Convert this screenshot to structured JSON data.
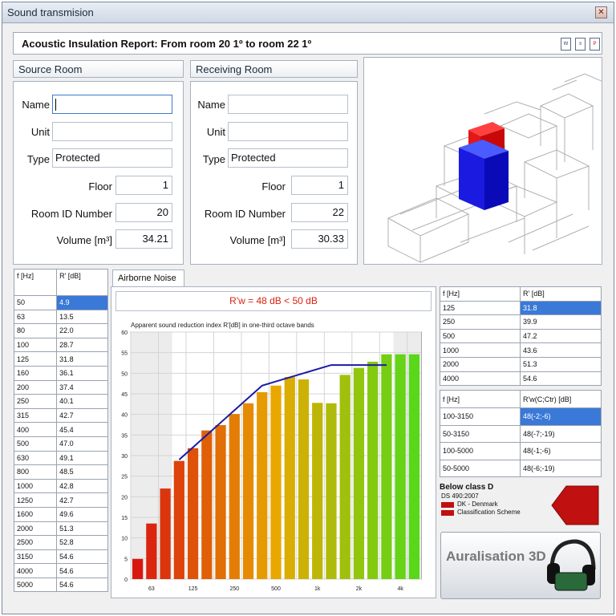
{
  "window": {
    "title": "Sound transmision",
    "close_icon": "✕"
  },
  "report": {
    "title": "Acoustic Insulation Report: From room 20  1º  to room 22  1º",
    "icons": [
      "word-document-icon",
      "export-document-icon",
      "pdf-document-icon"
    ]
  },
  "source_room": {
    "heading": "Source Room",
    "labels": {
      "name": "Name",
      "unit": "Unit",
      "type": "Type",
      "floor": "Floor",
      "room_id": "Room ID Number",
      "volume": "Volume [m³]"
    },
    "values": {
      "name": "",
      "unit": "",
      "type": "Protected",
      "floor": "1",
      "room_id": "20",
      "volume": "34.21"
    }
  },
  "receiving_room": {
    "heading": "Receiving Room",
    "labels": {
      "name": "Name",
      "unit": "Unit",
      "type": "Type",
      "floor": "Floor",
      "room_id": "Room ID Number",
      "volume": "Volume [m³]"
    },
    "values": {
      "name": "",
      "unit": "",
      "type": "Protected",
      "floor": "1",
      "room_id": "22",
      "volume": "30.33"
    }
  },
  "freq_table": {
    "headers": [
      "f [Hz]",
      "R' [dB]"
    ],
    "rows": [
      [
        "50",
        "4.9"
      ],
      [
        "63",
        "13.5"
      ],
      [
        "80",
        "22.0"
      ],
      [
        "100",
        "28.7"
      ],
      [
        "125",
        "31.8"
      ],
      [
        "160",
        "36.1"
      ],
      [
        "200",
        "37.4"
      ],
      [
        "250",
        "40.1"
      ],
      [
        "315",
        "42.7"
      ],
      [
        "400",
        "45.4"
      ],
      [
        "500",
        "47.0"
      ],
      [
        "630",
        "49.1"
      ],
      [
        "800",
        "48.5"
      ],
      [
        "1000",
        "42.8"
      ],
      [
        "1250",
        "42.7"
      ],
      [
        "1600",
        "49.6"
      ],
      [
        "2000",
        "51.3"
      ],
      [
        "2500",
        "52.8"
      ],
      [
        "3150",
        "54.6"
      ],
      [
        "4000",
        "54.6"
      ],
      [
        "5000",
        "54.6"
      ]
    ],
    "selected_row": 0
  },
  "tab": {
    "label": "Airborne Noise"
  },
  "result_banner": "R'w = 48 dB < 50 dB",
  "chart_data": {
    "type": "bar",
    "title": "Apparent sound reduction index R'[dB] in one-third octave bands",
    "categories": [
      "50",
      "63",
      "80",
      "100",
      "125",
      "160",
      "200",
      "250",
      "315",
      "400",
      "500",
      "630",
      "800",
      "1000",
      "1250",
      "1600",
      "2000",
      "2500",
      "3150",
      "4000",
      "5000"
    ],
    "values": [
      4.9,
      13.5,
      22.0,
      28.7,
      31.8,
      36.1,
      37.4,
      40.1,
      42.7,
      45.4,
      47.0,
      49.1,
      48.5,
      42.8,
      42.7,
      49.6,
      51.3,
      52.8,
      54.6,
      54.6,
      54.6
    ],
    "x_tick_labels": [
      "63",
      "125",
      "250",
      "500",
      "1k",
      "2k",
      "4k"
    ],
    "y_tick_labels": [
      "0",
      "5",
      "10",
      "15",
      "20",
      "25",
      "30",
      "35",
      "40",
      "45",
      "50",
      "55",
      "60"
    ],
    "ylim": [
      0,
      60
    ],
    "grid": true,
    "reference_curve": {
      "x": [
        "100",
        "125",
        "160",
        "200",
        "250",
        "315",
        "400",
        "500",
        "630",
        "800",
        "1000",
        "1250",
        "1600",
        "2000",
        "2500",
        "3150"
      ],
      "values": [
        29,
        32,
        35,
        38,
        41,
        44,
        47,
        48,
        49,
        50,
        51,
        52,
        52,
        52,
        52,
        52
      ]
    },
    "colors": {
      "low": "#d81810",
      "mid": "#e8a800",
      "high": "#58d818",
      "curve": "#1a1aa8"
    }
  },
  "octave_table": {
    "headers": [
      "f [Hz]",
      "R' [dB]"
    ],
    "rows": [
      [
        "125",
        "31.8"
      ],
      [
        "250",
        "39.9"
      ],
      [
        "500",
        "47.2"
      ],
      [
        "1000",
        "43.6"
      ],
      [
        "2000",
        "51.3"
      ],
      [
        "4000",
        "54.6"
      ]
    ],
    "selected_row": 0
  },
  "spectrum_table": {
    "headers": [
      "f [Hz]",
      "R'w(C;Ctr) [dB]"
    ],
    "rows": [
      [
        "100-3150",
        "48(-2;-6)"
      ],
      [
        "50-3150",
        "48(-7;-19)"
      ],
      [
        "100-5000",
        "48(-1;-6)"
      ],
      [
        "50-5000",
        "48(-6;-19)"
      ]
    ],
    "selected_row": 0
  },
  "classification": {
    "title": "Below class D",
    "standard": "DS 490:2007",
    "line1": "DK - Denmark",
    "line2": "Classification Scheme",
    "arrow_color": "#c01010"
  },
  "auralisation": {
    "label": "Auralisation 3D"
  }
}
